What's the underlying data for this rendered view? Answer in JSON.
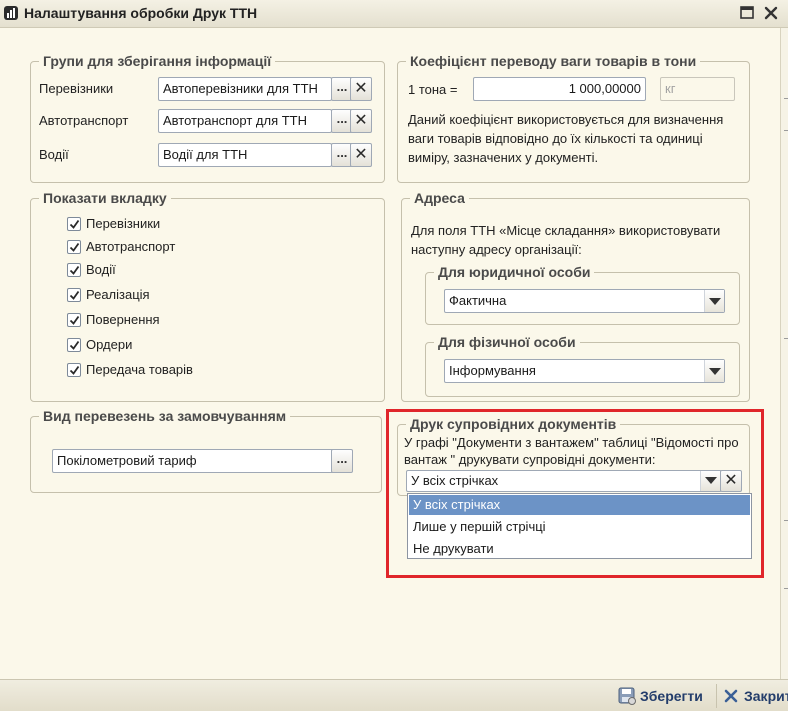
{
  "window": {
    "title": "Налаштування обробки Друк ТТН"
  },
  "storage_groups": {
    "legend": "Групи для зберігання інформації",
    "rows": [
      {
        "label": "Перевізники",
        "value": "Автоперевізники для ТТН"
      },
      {
        "label": "Автотранспорт",
        "value": "Автотранспорт для ТТН"
      },
      {
        "label": "Водії",
        "value": "Водії для ТТН"
      }
    ],
    "dots_label": "...",
    "clear_label": "✕"
  },
  "weight": {
    "legend": "Коефіцієнт переводу ваги товарів в тони",
    "prefix_label": "1 тона =",
    "value": "1 000,00000",
    "unit": "кг",
    "note": "Даний коефіцієнт використовується для визначення ваги товарів відповідно до їх кількості та одиниці виміру, зазначених у документі."
  },
  "tabs": {
    "legend": "Показати вкладку",
    "items": [
      {
        "label": "Перевізники",
        "checked": true
      },
      {
        "label": "Автотранспорт",
        "checked": true
      },
      {
        "label": "Водії",
        "checked": true
      },
      {
        "label": "Реалізація",
        "checked": true
      },
      {
        "label": "Повернення",
        "checked": true
      },
      {
        "label": "Ордери",
        "checked": true
      },
      {
        "label": "Передача товарів",
        "checked": true
      }
    ]
  },
  "address": {
    "legend": "Адреса",
    "note": "Для поля ТТН «Місце складання» використовувати наступну адресу організації:",
    "legal": {
      "legend": "Для юридичної особи",
      "value": "Фактична"
    },
    "individual": {
      "legend": "Для фізичної особи",
      "value": "Інформування"
    }
  },
  "transport": {
    "legend": "Вид перевезень за замовчуванням",
    "value": "Покілометровий тариф",
    "dots_label": "..."
  },
  "print_docs": {
    "legend": "Друк супровідних документів",
    "note": "У графі \"Документи з вантажем\" таблиці \"Відомості про вантаж \" друкувати супровідні документи:",
    "value": "У всіх стрічках",
    "options": [
      "У всіх стрічках",
      "Лише у першій стрічці",
      "Не друкувати"
    ],
    "selected_index": 0
  },
  "footer": {
    "save_label": "Зберегти",
    "close_label": "Закрити"
  },
  "colors": {
    "highlight": "#e0262b",
    "selection": "#6c93c6",
    "background": "#fbf8ea"
  },
  "icons": {
    "app": "app-chart-icon",
    "maximize": "maximize-icon",
    "close": "close-icon",
    "save": "save-disk-icon",
    "dropdown": "chevron-down-icon",
    "checkbox": "checkmark-icon"
  }
}
